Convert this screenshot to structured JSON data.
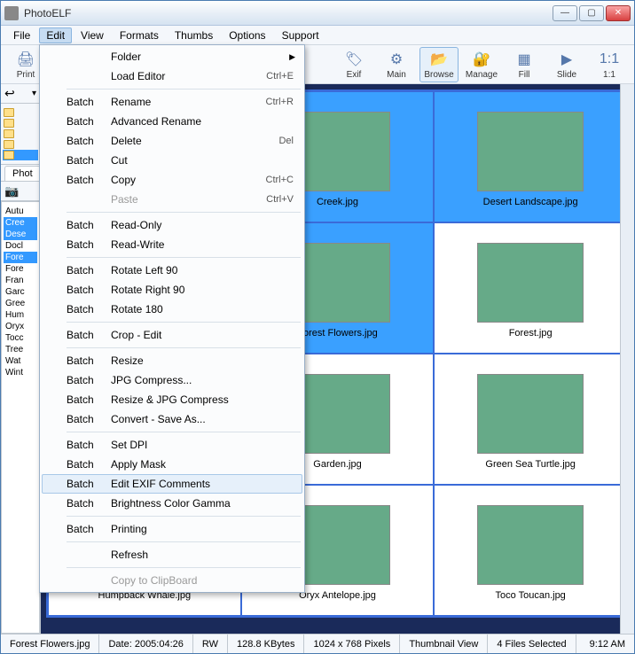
{
  "window": {
    "title": "PhotoELF"
  },
  "menubar": [
    "File",
    "Edit",
    "View",
    "Formats",
    "Thumbs",
    "Options",
    "Support"
  ],
  "menubar_active_index": 1,
  "toolbar_left": [
    {
      "label": "Print",
      "glyph": "🖨"
    }
  ],
  "toolbar_right": [
    {
      "label": "Exif",
      "glyph": "🏷"
    },
    {
      "label": "Main",
      "glyph": "⚙"
    },
    {
      "label": "Browse",
      "glyph": "📂",
      "active": true
    },
    {
      "label": "Manage",
      "glyph": "🔐"
    },
    {
      "label": "Fill",
      "glyph": "▦"
    },
    {
      "label": "Slide",
      "glyph": "▶"
    },
    {
      "label": "1:1",
      "glyph": "1:1"
    }
  ],
  "sidebar": {
    "tab": "Phot",
    "tree": [
      "",
      "",
      "",
      "",
      ""
    ],
    "files": [
      {
        "name": "Autu"
      },
      {
        "name": "Cree",
        "sel": true
      },
      {
        "name": "Dese",
        "sel": true
      },
      {
        "name": "Docl"
      },
      {
        "name": "Fore",
        "sel": true
      },
      {
        "name": "Fore"
      },
      {
        "name": "Fran"
      },
      {
        "name": "Garc"
      },
      {
        "name": "Gree"
      },
      {
        "name": "Hum"
      },
      {
        "name": "Oryx"
      },
      {
        "name": "Tocc"
      },
      {
        "name": "Tree"
      },
      {
        "name": "Wat"
      },
      {
        "name": "Wint"
      }
    ]
  },
  "thumbnails": [
    {
      "caption": "",
      "hidden": true
    },
    {
      "caption": "Creek.jpg",
      "sel": true,
      "sw": "sw-green"
    },
    {
      "caption": "Desert Landscape.jpg",
      "sel": true,
      "sw": "sw-desert"
    },
    {
      "caption": "",
      "hidden": true
    },
    {
      "caption": "Forest Flowers.jpg",
      "sel": true,
      "sw": "sw-flowers"
    },
    {
      "caption": "Forest.jpg",
      "sw": "sw-forest"
    },
    {
      "caption": "",
      "hidden": true
    },
    {
      "caption": "Garden.jpg",
      "sw": "sw-garden"
    },
    {
      "caption": "Green Sea Turtle.jpg",
      "sw": "sw-turtle"
    },
    {
      "caption": "Humpback Whale.jpg",
      "sw": "sw-whale"
    },
    {
      "caption": "Oryx Antelope.jpg",
      "sw": "sw-oryx"
    },
    {
      "caption": "Toco Toucan.jpg",
      "sw": "sw-toucan"
    }
  ],
  "edit_menu": [
    {
      "col2": "Folder",
      "arrow": true
    },
    {
      "col2": "Load Editor",
      "shortcut": "Ctrl+E",
      "sep_after": true
    },
    {
      "col1": "Batch",
      "col2": "Rename",
      "shortcut": "Ctrl+R"
    },
    {
      "col1": "Batch",
      "col2": "Advanced Rename"
    },
    {
      "col1": "Batch",
      "col2": "Delete",
      "shortcut": "Del"
    },
    {
      "col1": "Batch",
      "col2": "Cut"
    },
    {
      "col1": "Batch",
      "col2": "Copy",
      "shortcut": "Ctrl+C"
    },
    {
      "col2": "Paste",
      "shortcut": "Ctrl+V",
      "disabled": true,
      "sep_after": true
    },
    {
      "col1": "Batch",
      "col2": "Read-Only"
    },
    {
      "col1": "Batch",
      "col2": "Read-Write",
      "sep_after": true
    },
    {
      "col1": "Batch",
      "col2": "Rotate Left 90"
    },
    {
      "col1": "Batch",
      "col2": "Rotate Right 90"
    },
    {
      "col1": "Batch",
      "col2": "Rotate 180",
      "sep_after": true
    },
    {
      "col1": "Batch",
      "col2": "Crop - Edit",
      "sep_after": true
    },
    {
      "col1": "Batch",
      "col2": "Resize"
    },
    {
      "col1": "Batch",
      "col2": "JPG Compress..."
    },
    {
      "col1": "Batch",
      "col2": "Resize & JPG Compress"
    },
    {
      "col1": "Batch",
      "col2": "Convert - Save As...",
      "sep_after": true
    },
    {
      "col1": "Batch",
      "col2": "Set DPI"
    },
    {
      "col1": "Batch",
      "col2": "Apply Mask"
    },
    {
      "col1": "Batch",
      "col2": "Edit EXIF Comments",
      "hover": true
    },
    {
      "col1": "Batch",
      "col2": "Brightness Color Gamma",
      "sep_after": true
    },
    {
      "col1": "Batch",
      "col2": "Printing",
      "sep_after": true
    },
    {
      "col2": "Refresh",
      "sep_after": true
    },
    {
      "col2": "Copy to ClipBoard",
      "disabled": true
    }
  ],
  "statusbar": {
    "file": "Forest Flowers.jpg",
    "date": "Date: 2005:04:26",
    "rw": "RW",
    "size": "128.8 KBytes",
    "dims": "1024 x 768 Pixels",
    "view": "Thumbnail View",
    "sel": "4 Files Selected",
    "time": "9:12 AM"
  }
}
